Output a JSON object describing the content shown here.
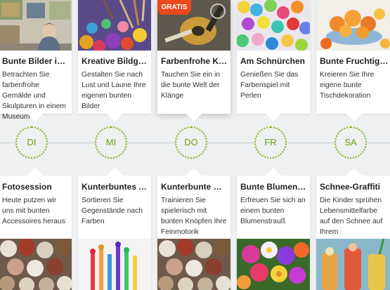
{
  "badge": {
    "label": "GRATIS"
  },
  "days": [
    {
      "label": "DI"
    },
    {
      "label": "MI"
    },
    {
      "label": "DO"
    },
    {
      "label": "FR"
    },
    {
      "label": "SA"
    }
  ],
  "top_cards": [
    {
      "title": "Bunte Bilder im ...",
      "desc": "Betrachten Sie farbenfrohe Gemälde und Skulpturen in einem Museum",
      "image": "museum-visitor-image"
    },
    {
      "title": "Kreative Bildgest...",
      "desc": "Gestalten Sie nach Lust und Laune Ihre eigenen bunten Bilder",
      "image": "paint-palette-image"
    },
    {
      "title": "Farbenfrohe Klän...",
      "desc": "Tauchen Sie ein in die bunte Welt der Klänge",
      "image": "music-instruments-image"
    },
    {
      "title": "Am Schnürchen",
      "desc": "Genießen Sie das Farbenspiel mit Perlen",
      "image": "colorful-beads-image"
    },
    {
      "title": "Bunte Fruchtige T...",
      "desc": "Kreieren Sie Ihre eigene bunte Tischdekoration",
      "image": "fruit-bowl-image"
    }
  ],
  "bottom_cards": [
    {
      "title": "Fotosession",
      "desc": "Heute putzen wir uns mit bunten Accessoires heraus",
      "image": "buttons-image"
    },
    {
      "title": "Kunterbuntes All...",
      "desc": "Sortieren Sie Gegenstände nach Farben",
      "image": "paint-brushes-image"
    },
    {
      "title": "Kunterbunte Kno...",
      "desc": "Trainieren Sie spielerisch mit bunten Knöpfen Ihre Feinmotorik",
      "image": "buttons-image-2"
    },
    {
      "title": "Bunte Blumen ric...",
      "desc": "Erfreuen Sie sich an einem bunten Blumenstrauß",
      "image": "flower-bouquet-image"
    },
    {
      "title": "Schnee-Graffiti",
      "desc": "Die Kinder sprühen Lebensmittelfarbe auf den Schnee auf Ihrem Außengelände.",
      "image": "colored-drinks-image"
    }
  ]
}
